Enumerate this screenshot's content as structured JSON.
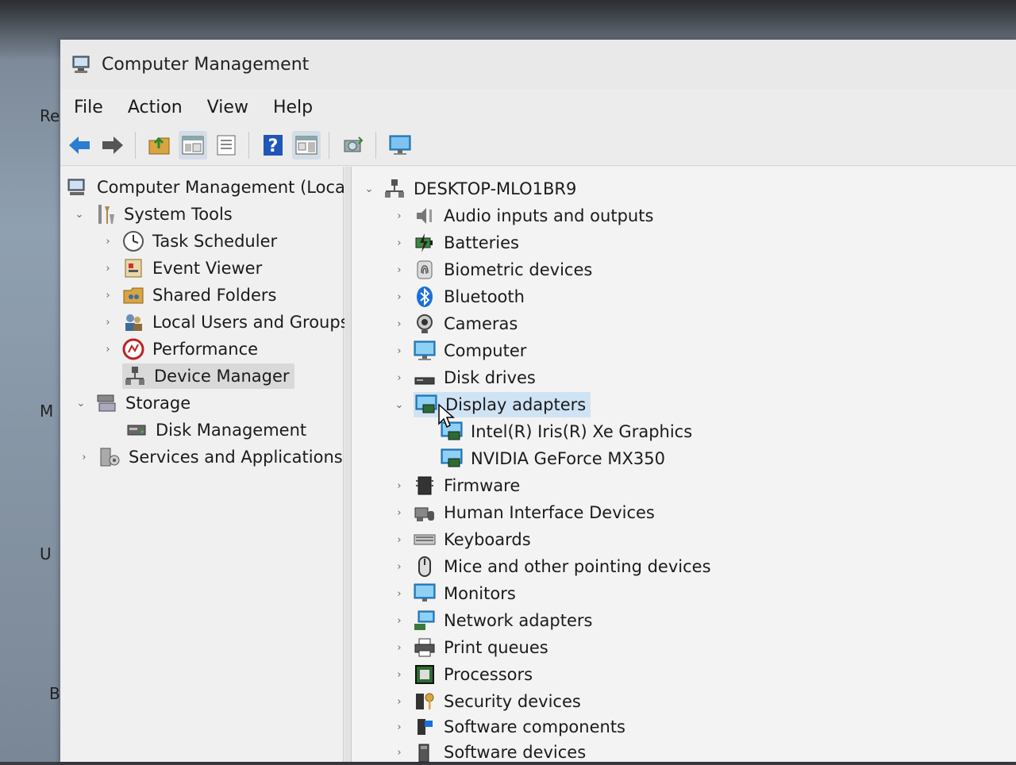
{
  "desktop": {
    "labels": [
      "Re",
      "M",
      "U",
      "Ba"
    ]
  },
  "window": {
    "title": "Computer Management",
    "menu": [
      "File",
      "Action",
      "View",
      "Help"
    ],
    "toolbar": [
      "back-icon",
      "forward-icon",
      "up-folder-icon",
      "show-hide-tree-icon",
      "properties-icon",
      "help-icon",
      "show-action-pane-icon",
      "scan-hardware-icon",
      "monitor-icon"
    ]
  },
  "left_tree": {
    "root": "Computer Management (Local)",
    "system_tools": "System Tools",
    "task_scheduler": "Task Scheduler",
    "event_viewer": "Event Viewer",
    "shared_folders": "Shared Folders",
    "local_users": "Local Users and Groups",
    "performance": "Performance",
    "device_manager": "Device Manager",
    "storage": "Storage",
    "disk_management": "Disk Management",
    "services": "Services and Applications"
  },
  "device_tree": {
    "computer_name": "DESKTOP-MLO1BR9",
    "categories": [
      "Audio inputs and outputs",
      "Batteries",
      "Biometric devices",
      "Bluetooth",
      "Cameras",
      "Computer",
      "Disk drives",
      "Display adapters",
      "Firmware",
      "Human Interface Devices",
      "Keyboards",
      "Mice and other pointing devices",
      "Monitors",
      "Network adapters",
      "Print queues",
      "Processors",
      "Security devices",
      "Software components",
      "Software devices"
    ],
    "display_adapters": [
      "Intel(R) Iris(R) Xe Graphics",
      "NVIDIA GeForce MX350"
    ]
  }
}
